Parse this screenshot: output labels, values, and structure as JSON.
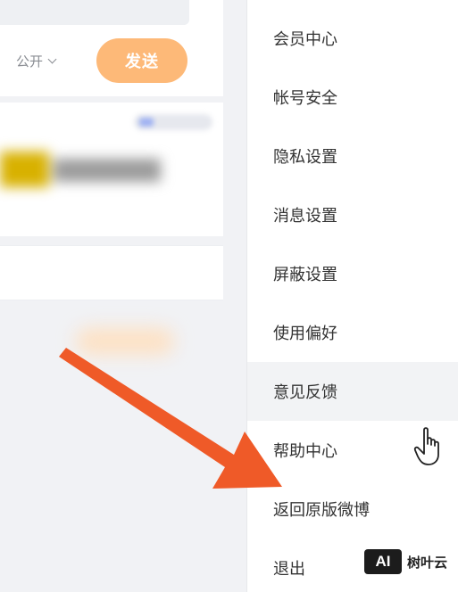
{
  "composer": {
    "visibility_label": "公开",
    "send_label": "发送"
  },
  "menu": {
    "items": [
      {
        "label": "会员中心"
      },
      {
        "label": "帐号安全"
      },
      {
        "label": "隐私设置"
      },
      {
        "label": "消息设置"
      },
      {
        "label": "屏蔽设置"
      },
      {
        "label": "使用偏好"
      },
      {
        "label": "意见反馈"
      },
      {
        "label": "帮助中心"
      },
      {
        "label": "返回原版微博"
      },
      {
        "label": "退出"
      }
    ],
    "hovered_index": 6
  },
  "annotation": {
    "arrow_color": "#ef5a28"
  },
  "watermark": {
    "logo_text": "AI",
    "brand_text": "树叶云"
  },
  "colors": {
    "send_button": "#fdb978",
    "menu_text": "#333333",
    "hover_bg": "#f2f3f5"
  }
}
